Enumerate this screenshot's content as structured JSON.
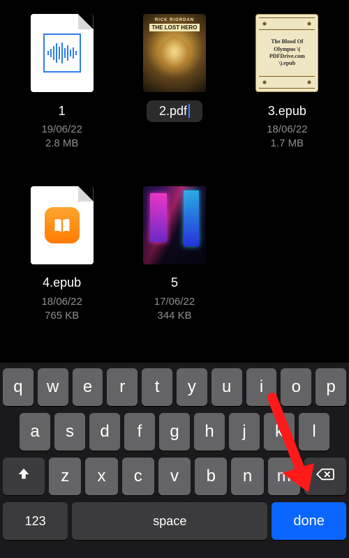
{
  "files": [
    {
      "name": "1",
      "date": "19/06/22",
      "size": "2.8 MB"
    },
    {
      "name": "2.pdf",
      "date": "",
      "size": ""
    },
    {
      "name": "3.epub",
      "date": "18/06/22",
      "size": "1.7 MB"
    },
    {
      "name": "4.epub",
      "date": "18/06/22",
      "size": "765 KB"
    },
    {
      "name": "5",
      "date": "17/06/22",
      "size": "344 KB"
    }
  ],
  "rename": {
    "value": "2.pdf"
  },
  "cover3_text": "The Blood Of Olympus \\( PDFDrive.com \\).epub",
  "cover1": {
    "top": "RICK RIORDAN",
    "banner": "THE LOST HERO"
  },
  "keyboard": {
    "row1": [
      "q",
      "w",
      "e",
      "r",
      "t",
      "y",
      "u",
      "i",
      "o",
      "p"
    ],
    "row2": [
      "a",
      "s",
      "d",
      "f",
      "g",
      "h",
      "j",
      "k",
      "l"
    ],
    "row3": [
      "z",
      "x",
      "c",
      "v",
      "b",
      "n",
      "m"
    ],
    "numeric": "123",
    "space": "space",
    "done": "done"
  }
}
